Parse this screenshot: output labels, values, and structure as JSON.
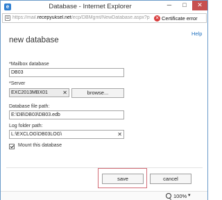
{
  "window": {
    "title": "Database - Internet Explorer",
    "app_icon_glyph": "e",
    "minimize_glyph": "─",
    "maximize_glyph": "□",
    "close_glyph": "✕"
  },
  "addressbar": {
    "url_prefix": "https://mail.",
    "url_host": "recepyuksel.net",
    "url_path": "/ecp/DBMgmt/NewDatabase.aspx?p",
    "cert_icon_glyph": "✕",
    "cert_text": "Certificate error"
  },
  "page": {
    "help_link": "Help",
    "heading": "new database"
  },
  "form": {
    "mailbox_db_label": "*Mailbox database",
    "mailbox_db_value": "DB03",
    "server_label": "*Server",
    "server_value": "EXC2013MBX01",
    "server_clear_glyph": "✕",
    "browse_label": "browse...",
    "db_path_label": "Database file path:",
    "db_path_value": "E:\\DB\\DB03\\DB03.edb",
    "log_path_label": "Log folder path:",
    "log_path_value": "L:\\EXCLOG\\DB03LOG\\",
    "log_clear_glyph": "✕",
    "mount_label": "Mount this database",
    "mount_checked": true
  },
  "buttons": {
    "save": "save",
    "cancel": "cancel"
  },
  "statusbar": {
    "zoom": "100%",
    "zoom_chevron": "▾"
  },
  "colors": {
    "window_border": "#6b9bc9",
    "close_button": "#c75050",
    "link": "#1f6fbd",
    "cert_error": "#d83b3b",
    "save_highlight": "#d26c76"
  }
}
